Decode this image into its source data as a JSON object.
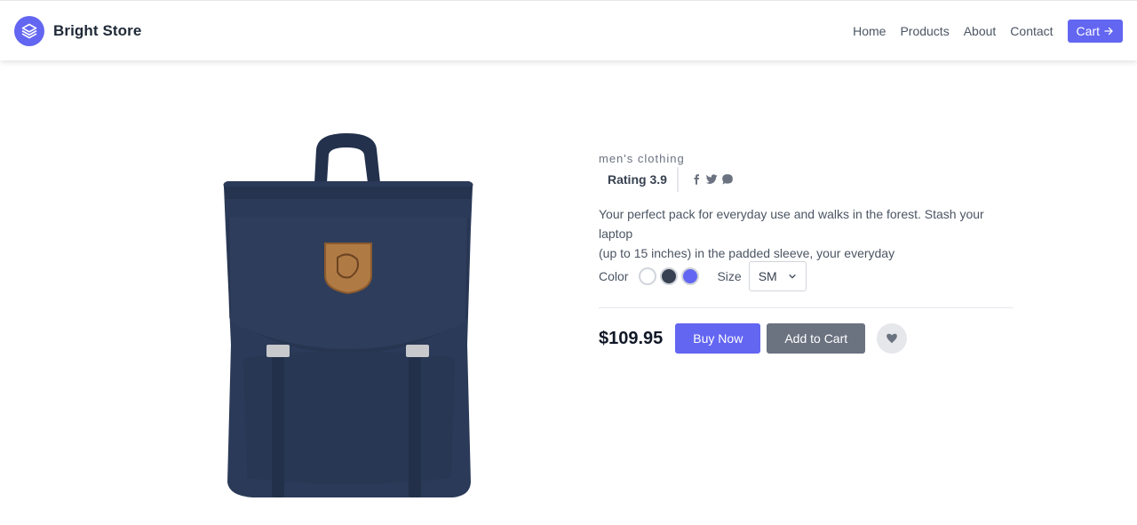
{
  "header": {
    "brand": "Bright Store",
    "nav": [
      "Home",
      "Products",
      "About",
      "Contact"
    ],
    "cart_label": "Cart"
  },
  "product": {
    "category": "men's clothing",
    "rating_text": "Rating 3.9",
    "description_lines": [
      "Your perfect pack for everyday use and walks in the forest. Stash your laptop",
      "(up to 15 inches) in the padded sleeve, your everyday"
    ],
    "color_label": "Color",
    "colors": [
      "#ffffff",
      "#374151",
      "#6366f1"
    ],
    "size_label": "Size",
    "size_value": "SM",
    "price": "$109.95",
    "buy_label": "Buy Now",
    "add_label": "Add to Cart"
  },
  "theme": {
    "accent": "#6366f1",
    "secondary": "#6b7280"
  }
}
